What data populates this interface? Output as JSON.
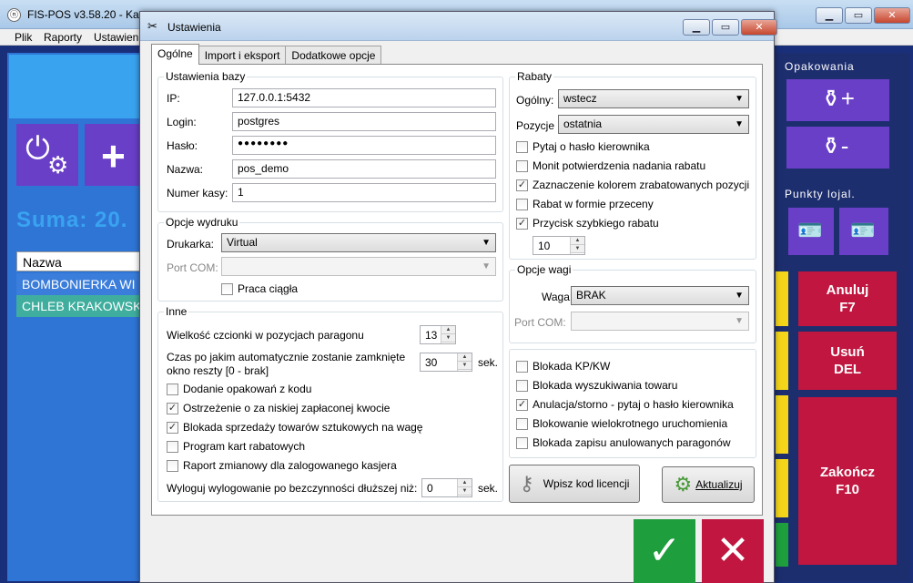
{
  "app": {
    "title": "FIS-POS v3.58.20 - Kasa",
    "menu": [
      "Plik",
      "Raporty",
      "Ustawien"
    ],
    "suma_label": "Suma: 20.",
    "list_header": "Nazwa",
    "list_rows": [
      "BOMBONIERKA WI",
      "CHLEB KRAKOWSK"
    ],
    "opakowania_label": "Opakowania",
    "punkty_label": "Punkty lojal.",
    "anuluj": "Anuluj\nF7",
    "anuluj_line1": "Anuluj",
    "anuluj_line2": "F7",
    "usun_line1": "Usuń",
    "usun_line2": "DEL",
    "zakoncz_line1": "Zakończ",
    "zakoncz_line2": "F10"
  },
  "dialog": {
    "title": "Ustawienia",
    "tabs": [
      "Ogólne",
      "Import i eksport",
      "Dodatkowe opcje"
    ],
    "baza": {
      "legend": "Ustawienia bazy",
      "ip_label": "IP:",
      "ip_value": "127.0.0.1:5432",
      "login_label": "Login:",
      "login_value": "postgres",
      "haslo_label": "Hasło:",
      "haslo_value": "●●●●●●●●",
      "nazwa_label": "Nazwa:",
      "nazwa_value": "pos_demo",
      "numer_label": "Numer kasy:",
      "numer_value": "1"
    },
    "wydruk": {
      "legend": "Opcje wydruku",
      "drukarka_label": "Drukarka:",
      "drukarka_value": "Virtual",
      "port_label": "Port COM:",
      "port_value": "",
      "praca_label": "Praca ciągła"
    },
    "inne": {
      "legend": "Inne",
      "wielkosc_label": "Wielkość czcionki w pozycjach paragonu",
      "wielkosc_value": "13",
      "czas_label_1": "Czas po jakim automatycznie zostanie zamknięte",
      "czas_label_2": "okno reszty [0 - brak]",
      "czas_value": "30",
      "sek1": "sek.",
      "checks": [
        {
          "label": "Dodanie opakowań z kodu",
          "checked": false
        },
        {
          "label": "Ostrzeżenie o za niskiej zapłaconej kwocie",
          "checked": true
        },
        {
          "label": "Blokada sprzedaży towarów sztukowych na wagę",
          "checked": true
        },
        {
          "label": "Program kart rabatowych",
          "checked": false
        },
        {
          "label": "Raport zmianowy dla zalogowanego kasjera",
          "checked": false
        }
      ],
      "wyloguj_label": "Wyloguj wylogowanie po bezczynności dłuższej niż:",
      "wyloguj_value": "0",
      "sek2": "sek."
    },
    "rabaty": {
      "legend": "Rabaty",
      "ogolny_label": "Ogólny:",
      "ogolny_value": "wstecz",
      "pozycje_label": "Pozycje",
      "pozycje_value": "ostatnia",
      "checks": [
        {
          "label": "Pytaj o hasło kierownika",
          "checked": false
        },
        {
          "label": "Monit potwierdzenia nadania rabatu",
          "checked": false
        },
        {
          "label": "Zaznaczenie kolorem zrabatowanych pozycji",
          "checked": true
        },
        {
          "label": "Rabat w formie przeceny",
          "checked": false
        },
        {
          "label": "Przycisk szybkiego rabatu",
          "checked": true
        }
      ],
      "szybki_value": "10"
    },
    "waga": {
      "legend": "Opcje wagi",
      "waga_label": "Waga:",
      "waga_value": "BRAK",
      "port_label": "Port COM:",
      "port_value": ""
    },
    "blokady": [
      {
        "label": "Blokada KP/KW",
        "checked": false
      },
      {
        "label": "Blokada wyszukiwania towaru",
        "checked": false
      },
      {
        "label": "Anulacja/storno - pytaj o hasło kierownika",
        "checked": true
      },
      {
        "label": "Blokowanie wielokrotnego uruchomienia",
        "checked": false
      },
      {
        "label": "Blokada zapisu anulowanych paragonów",
        "checked": false
      }
    ],
    "licencja_label": "Wpisz kod licencji",
    "aktualizuj_label": "Aktualizuj",
    "ok_symbol": "✓",
    "cancel_symbol": "✕"
  }
}
